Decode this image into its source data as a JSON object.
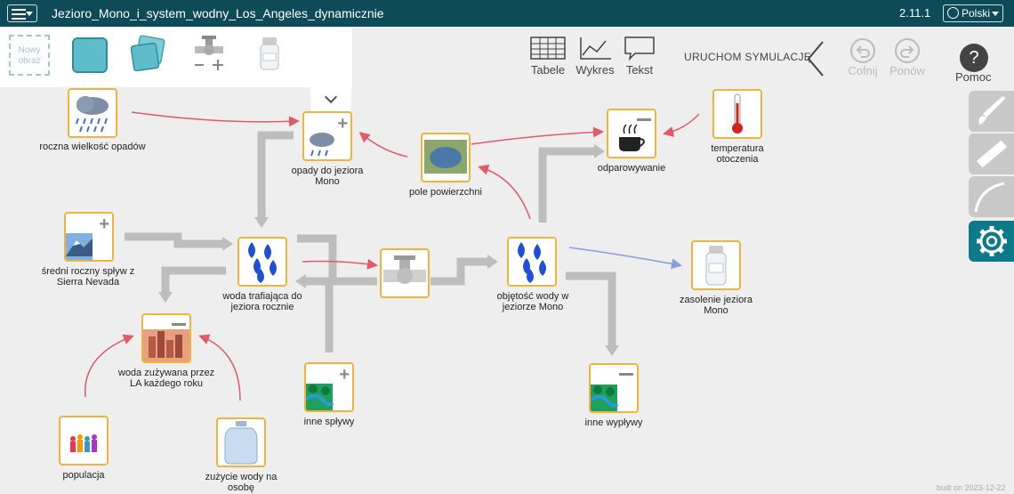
{
  "header": {
    "title": "Jezioro_Mono_i_system_wodny_Los_Angeles_dynamicznie",
    "version": "2.11.1",
    "language": "Polski"
  },
  "toolbar": {
    "new_image_label": "Nowy obraz",
    "tables_label": "Tabele",
    "chart_label": "Wykres",
    "text_label": "Tekst",
    "run_simulation_label": "URUCHOM SYMULACJĘ",
    "undo_label": "Cofnij",
    "redo_label": "Ponów",
    "help_label": "Pomoc"
  },
  "diagram": {
    "nodes": {
      "precipitation_annual": "roczna wielkość opadów",
      "lake_precipitation": "opady do jeziora Mono",
      "surface_area": "pole powierzchni",
      "evaporation": "odparowywanie",
      "temperature": "temperatura otoczenia",
      "sierra_runoff": "średni roczny spływ z Sierra Nevada",
      "water_to_lake": "woda trafiająca do jeziora rocznie",
      "lake_volume": "objętość wody w jeziorze Mono",
      "salinity": "zasolenie jeziora Mono",
      "la_water_use": "woda zużywana przez LA każdego roku",
      "other_inflows": "inne spływy",
      "other_outflows": "inne wypływy",
      "population": "populacja",
      "per_capita_use": "zużycie wody na osobę"
    }
  },
  "footer": {
    "built": "built on 2023-12-22"
  },
  "colors": {
    "header_bg": "#0d4b59",
    "node_border": "#f0b43c",
    "link_red": "#e05a6a",
    "link_blue": "#8a9ce0",
    "flow_gray": "#bdbdbd",
    "side_active": "#0d7a8c"
  }
}
